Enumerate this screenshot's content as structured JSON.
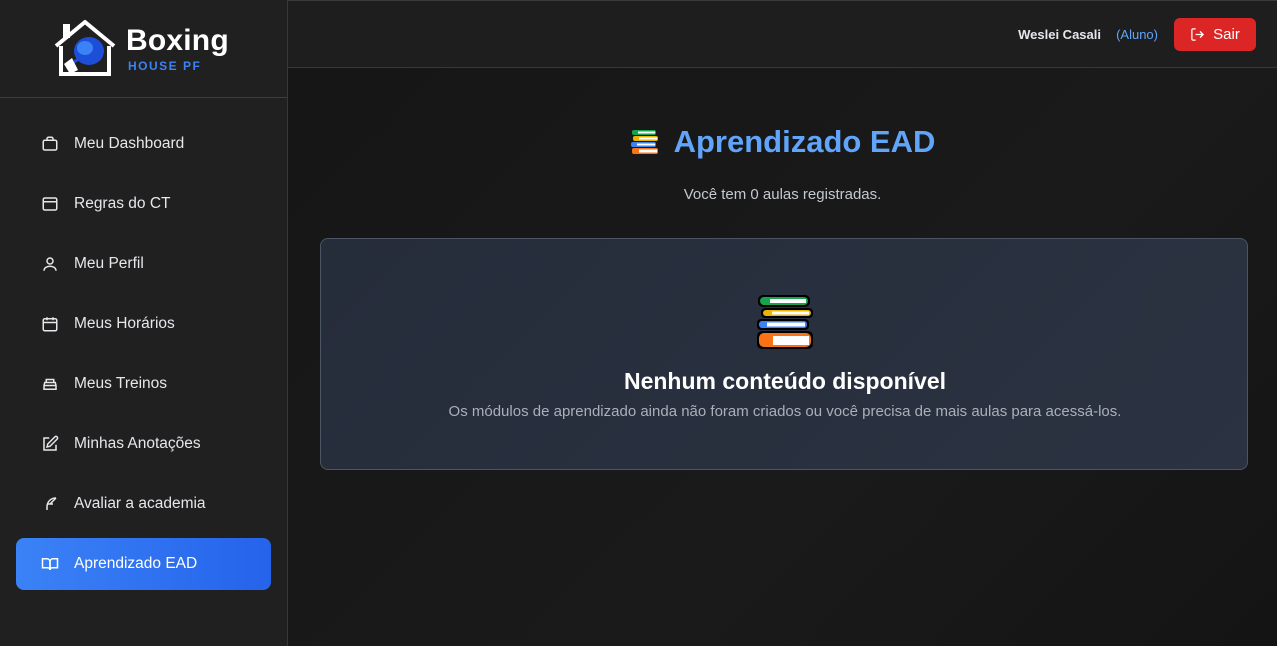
{
  "brand": {
    "name": "Boxing",
    "tagline": "HOUSE PF"
  },
  "sidebar": {
    "items": [
      {
        "label": "Meu Dashboard",
        "icon": "briefcase-icon",
        "active": false
      },
      {
        "label": "Regras do CT",
        "icon": "window-icon",
        "active": false
      },
      {
        "label": "Meu Perfil",
        "icon": "user-icon",
        "active": false
      },
      {
        "label": "Meus Horários",
        "icon": "calendar-icon",
        "active": false
      },
      {
        "label": "Meus Treinos",
        "icon": "dumbbell-icon",
        "active": false
      },
      {
        "label": "Minhas Anotações",
        "icon": "edit-icon",
        "active": false
      },
      {
        "label": "Avaliar a academia",
        "icon": "feather-icon",
        "active": false
      },
      {
        "label": "Aprendizado EAD",
        "icon": "book-open-icon",
        "active": true
      }
    ]
  },
  "header": {
    "user_name": "Weslei Casali",
    "user_role": "(Aluno)",
    "logout_label": "Sair"
  },
  "main": {
    "title": "Aprendizado EAD",
    "title_icon": "books-icon",
    "subtitle": "Você tem 0 aulas registradas.",
    "empty_state": {
      "icon": "books-icon",
      "title": "Nenhum conteúdo disponível",
      "description": "Os módulos de aprendizado ainda não foram criados ou você precisa de mais aulas para acessá-los."
    }
  },
  "colors": {
    "accent": "#60a5fa",
    "active_nav": "#2563eb",
    "logout": "#dc2626"
  }
}
